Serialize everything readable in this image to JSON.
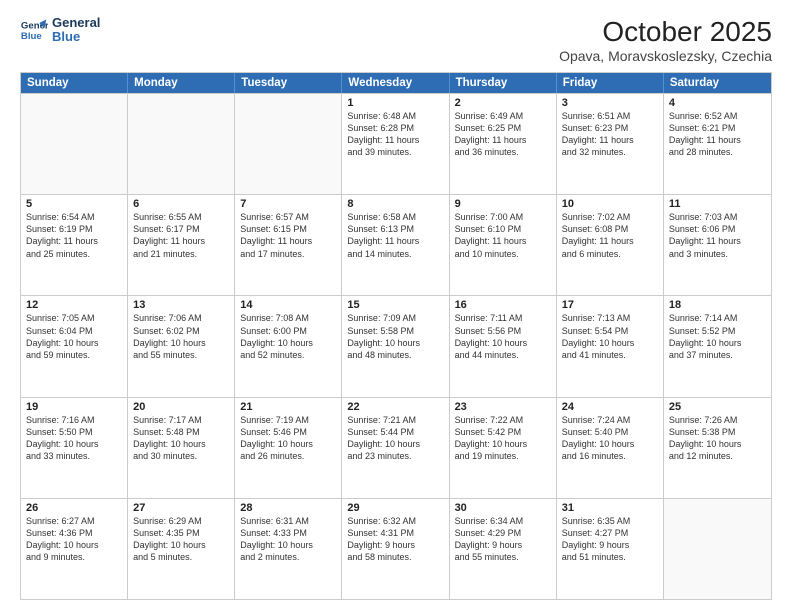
{
  "logo": {
    "line1": "General",
    "line2": "Blue"
  },
  "title": "October 2025",
  "subtitle": "Opava, Moravskoslezsky, Czechia",
  "header_days": [
    "Sunday",
    "Monday",
    "Tuesday",
    "Wednesday",
    "Thursday",
    "Friday",
    "Saturday"
  ],
  "weeks": [
    [
      {
        "day": "",
        "info": ""
      },
      {
        "day": "",
        "info": ""
      },
      {
        "day": "",
        "info": ""
      },
      {
        "day": "1",
        "info": "Sunrise: 6:48 AM\nSunset: 6:28 PM\nDaylight: 11 hours\nand 39 minutes."
      },
      {
        "day": "2",
        "info": "Sunrise: 6:49 AM\nSunset: 6:25 PM\nDaylight: 11 hours\nand 36 minutes."
      },
      {
        "day": "3",
        "info": "Sunrise: 6:51 AM\nSunset: 6:23 PM\nDaylight: 11 hours\nand 32 minutes."
      },
      {
        "day": "4",
        "info": "Sunrise: 6:52 AM\nSunset: 6:21 PM\nDaylight: 11 hours\nand 28 minutes."
      }
    ],
    [
      {
        "day": "5",
        "info": "Sunrise: 6:54 AM\nSunset: 6:19 PM\nDaylight: 11 hours\nand 25 minutes."
      },
      {
        "day": "6",
        "info": "Sunrise: 6:55 AM\nSunset: 6:17 PM\nDaylight: 11 hours\nand 21 minutes."
      },
      {
        "day": "7",
        "info": "Sunrise: 6:57 AM\nSunset: 6:15 PM\nDaylight: 11 hours\nand 17 minutes."
      },
      {
        "day": "8",
        "info": "Sunrise: 6:58 AM\nSunset: 6:13 PM\nDaylight: 11 hours\nand 14 minutes."
      },
      {
        "day": "9",
        "info": "Sunrise: 7:00 AM\nSunset: 6:10 PM\nDaylight: 11 hours\nand 10 minutes."
      },
      {
        "day": "10",
        "info": "Sunrise: 7:02 AM\nSunset: 6:08 PM\nDaylight: 11 hours\nand 6 minutes."
      },
      {
        "day": "11",
        "info": "Sunrise: 7:03 AM\nSunset: 6:06 PM\nDaylight: 11 hours\nand 3 minutes."
      }
    ],
    [
      {
        "day": "12",
        "info": "Sunrise: 7:05 AM\nSunset: 6:04 PM\nDaylight: 10 hours\nand 59 minutes."
      },
      {
        "day": "13",
        "info": "Sunrise: 7:06 AM\nSunset: 6:02 PM\nDaylight: 10 hours\nand 55 minutes."
      },
      {
        "day": "14",
        "info": "Sunrise: 7:08 AM\nSunset: 6:00 PM\nDaylight: 10 hours\nand 52 minutes."
      },
      {
        "day": "15",
        "info": "Sunrise: 7:09 AM\nSunset: 5:58 PM\nDaylight: 10 hours\nand 48 minutes."
      },
      {
        "day": "16",
        "info": "Sunrise: 7:11 AM\nSunset: 5:56 PM\nDaylight: 10 hours\nand 44 minutes."
      },
      {
        "day": "17",
        "info": "Sunrise: 7:13 AM\nSunset: 5:54 PM\nDaylight: 10 hours\nand 41 minutes."
      },
      {
        "day": "18",
        "info": "Sunrise: 7:14 AM\nSunset: 5:52 PM\nDaylight: 10 hours\nand 37 minutes."
      }
    ],
    [
      {
        "day": "19",
        "info": "Sunrise: 7:16 AM\nSunset: 5:50 PM\nDaylight: 10 hours\nand 33 minutes."
      },
      {
        "day": "20",
        "info": "Sunrise: 7:17 AM\nSunset: 5:48 PM\nDaylight: 10 hours\nand 30 minutes."
      },
      {
        "day": "21",
        "info": "Sunrise: 7:19 AM\nSunset: 5:46 PM\nDaylight: 10 hours\nand 26 minutes."
      },
      {
        "day": "22",
        "info": "Sunrise: 7:21 AM\nSunset: 5:44 PM\nDaylight: 10 hours\nand 23 minutes."
      },
      {
        "day": "23",
        "info": "Sunrise: 7:22 AM\nSunset: 5:42 PM\nDaylight: 10 hours\nand 19 minutes."
      },
      {
        "day": "24",
        "info": "Sunrise: 7:24 AM\nSunset: 5:40 PM\nDaylight: 10 hours\nand 16 minutes."
      },
      {
        "day": "25",
        "info": "Sunrise: 7:26 AM\nSunset: 5:38 PM\nDaylight: 10 hours\nand 12 minutes."
      }
    ],
    [
      {
        "day": "26",
        "info": "Sunrise: 6:27 AM\nSunset: 4:36 PM\nDaylight: 10 hours\nand 9 minutes."
      },
      {
        "day": "27",
        "info": "Sunrise: 6:29 AM\nSunset: 4:35 PM\nDaylight: 10 hours\nand 5 minutes."
      },
      {
        "day": "28",
        "info": "Sunrise: 6:31 AM\nSunset: 4:33 PM\nDaylight: 10 hours\nand 2 minutes."
      },
      {
        "day": "29",
        "info": "Sunrise: 6:32 AM\nSunset: 4:31 PM\nDaylight: 9 hours\nand 58 minutes."
      },
      {
        "day": "30",
        "info": "Sunrise: 6:34 AM\nSunset: 4:29 PM\nDaylight: 9 hours\nand 55 minutes."
      },
      {
        "day": "31",
        "info": "Sunrise: 6:35 AM\nSunset: 4:27 PM\nDaylight: 9 hours\nand 51 minutes."
      },
      {
        "day": "",
        "info": ""
      }
    ]
  ]
}
